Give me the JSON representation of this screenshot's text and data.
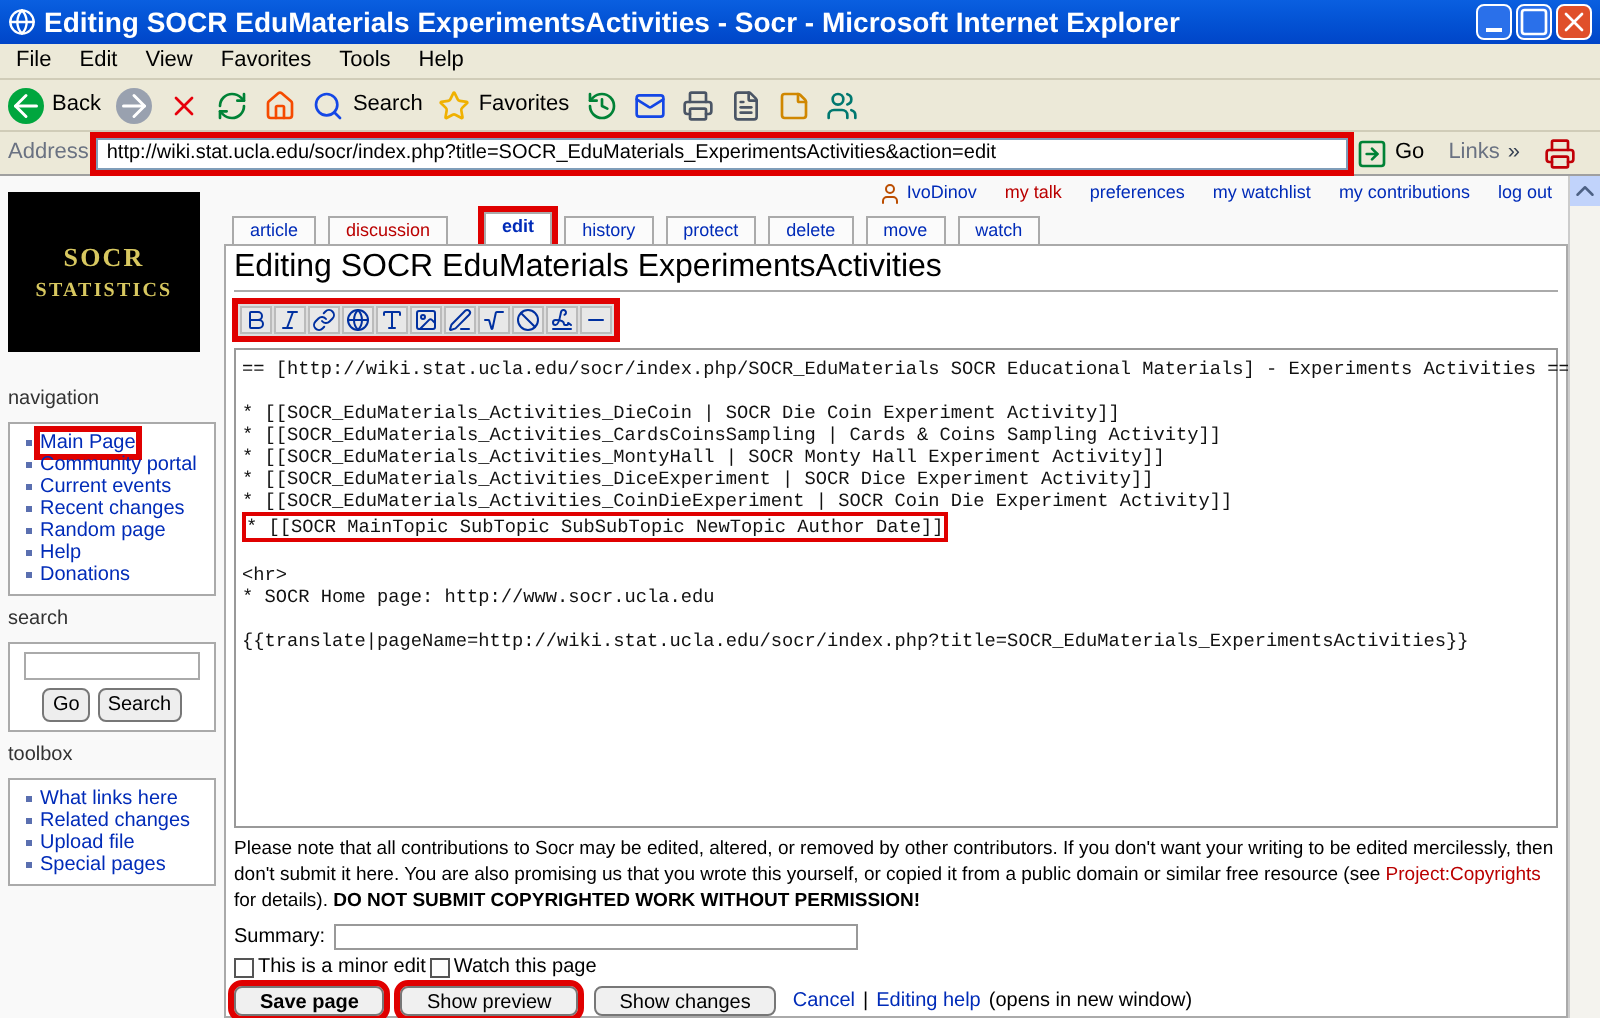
{
  "window": {
    "title": "Editing SOCR EduMaterials ExperimentsActivities - Socr - Microsoft Internet Explorer"
  },
  "menu": [
    "File",
    "Edit",
    "View",
    "Favorites",
    "Tools",
    "Help"
  ],
  "toolbar": {
    "back": "Back",
    "search": "Search",
    "favorites": "Favorites"
  },
  "address": {
    "label": "Address",
    "url": "http://wiki.stat.ucla.edu/socr/index.php?title=SOCR_EduMaterials_ExperimentsActivities&action=edit",
    "highlighted": true,
    "go": "Go",
    "links": "Links",
    "more": "»"
  },
  "user_links": [
    {
      "label": "IvoDinov",
      "kind": "user"
    },
    {
      "label": "my talk",
      "kind": "new"
    },
    {
      "label": "preferences",
      "kind": "link"
    },
    {
      "label": "my watchlist",
      "kind": "link"
    },
    {
      "label": "my contributions",
      "kind": "link"
    },
    {
      "label": "log out",
      "kind": "link"
    }
  ],
  "tabs": [
    {
      "label": "article",
      "selected": false,
      "highlighted": false,
      "kind": "link"
    },
    {
      "label": "discussion",
      "selected": false,
      "highlighted": false,
      "kind": "new"
    },
    {
      "label": "edit",
      "selected": true,
      "highlighted": true,
      "kind": "link"
    },
    {
      "label": "history",
      "selected": false,
      "highlighted": false,
      "kind": "link"
    },
    {
      "label": "protect",
      "selected": false,
      "highlighted": false,
      "kind": "link"
    },
    {
      "label": "delete",
      "selected": false,
      "highlighted": false,
      "kind": "link"
    },
    {
      "label": "move",
      "selected": false,
      "highlighted": false,
      "kind": "link"
    },
    {
      "label": "watch",
      "selected": false,
      "highlighted": false,
      "kind": "link"
    }
  ],
  "logo": {
    "line1": "SOCR",
    "line2": "STATISTICS"
  },
  "sidebar": {
    "navigation": {
      "title": "navigation",
      "items": [
        {
          "label": "Main Page",
          "highlighted": true
        },
        {
          "label": "Community portal",
          "highlighted": false
        },
        {
          "label": "Current events",
          "highlighted": false
        },
        {
          "label": "Recent changes",
          "highlighted": false
        },
        {
          "label": "Random page",
          "highlighted": false
        },
        {
          "label": "Help",
          "highlighted": false
        },
        {
          "label": "Donations",
          "highlighted": false
        }
      ]
    },
    "search": {
      "title": "search",
      "buttons": [
        "Go",
        "Search"
      ]
    },
    "toolbox": {
      "title": "toolbox",
      "items": [
        "What links here",
        "Related changes",
        "Upload file",
        "Special pages"
      ]
    }
  },
  "heading": "Editing SOCR EduMaterials ExperimentsActivities",
  "edit_toolbar": {
    "highlighted": true
  },
  "editor_blocks": [
    {
      "lines": [
        {
          "text": "== [http://wiki.stat.ucla.edu/socr/index.php/SOCR_EduMaterials SOCR Educational Materials] - Experiments Activities ==",
          "highlighted": false
        }
      ]
    },
    {
      "lines": [
        {
          "text": "* [[SOCR_EduMaterials_Activities_DieCoin | SOCR Die Coin Experiment Activity]]",
          "highlighted": false
        },
        {
          "text": "* [[SOCR_EduMaterials_Activities_CardsCoinsSampling | Cards & Coins Sampling Activity]]",
          "highlighted": false
        },
        {
          "text": "* [[SOCR_EduMaterials_Activities_MontyHall | SOCR Monty Hall Experiment Activity]]",
          "highlighted": false
        },
        {
          "text": "* [[SOCR_EduMaterials_Activities_DiceExperiment | SOCR Dice Experiment Activity]]",
          "highlighted": false
        },
        {
          "text": "* [[SOCR_EduMaterials_Activities_CoinDieExperiment | SOCR Coin Die Experiment Activity]]",
          "highlighted": false
        },
        {
          "text": "* [[SOCR MainTopic SubTopic SubSubTopic NewTopic Author Date]]",
          "highlighted": true
        }
      ]
    },
    {
      "lines": [
        {
          "text": "<hr>",
          "highlighted": false
        },
        {
          "text": "* SOCR Home page: http://www.socr.ucla.edu",
          "highlighted": false
        }
      ]
    },
    {
      "lines": [
        {
          "text": "{{translate|pageName=http://wiki.stat.ucla.edu/socr/index.php?title=SOCR_EduMaterials_ExperimentsActivities}}",
          "highlighted": false
        }
      ]
    }
  ],
  "notice": "Please note that all contributions to Socr may be edited, altered, or removed by other contributors. If you don't want your writing to be edited mercilessly, then don't submit it here. You are also promising us that you wrote this yourself, or copied it from a public domain or similar free resource (see",
  "notice_link": "Project:Copyrights",
  "notice_end": "for details). **DO NOT SUBMIT COPYRIGHTED WORK WITHOUT PERMISSION!**",
  "summary": {
    "label": "Summary:"
  },
  "checkboxes": [
    {
      "label": "This is a minor edit",
      "checked": false
    },
    {
      "label": "Watch this page",
      "checked": false
    }
  ],
  "buttons": [
    {
      "label": "Save page",
      "highlighted": true,
      "primary": true
    },
    {
      "label": "Show preview",
      "highlighted": true,
      "primary": false
    },
    {
      "label": "Show changes",
      "highlighted": false,
      "primary": false
    }
  ],
  "footer_links": [
    {
      "label": "Cancel",
      "kind": "link"
    },
    {
      "label": "|",
      "kind": "text"
    },
    {
      "label": "Editing help",
      "kind": "link"
    },
    {
      "label": "(opens in new window)",
      "kind": "text"
    }
  ]
}
